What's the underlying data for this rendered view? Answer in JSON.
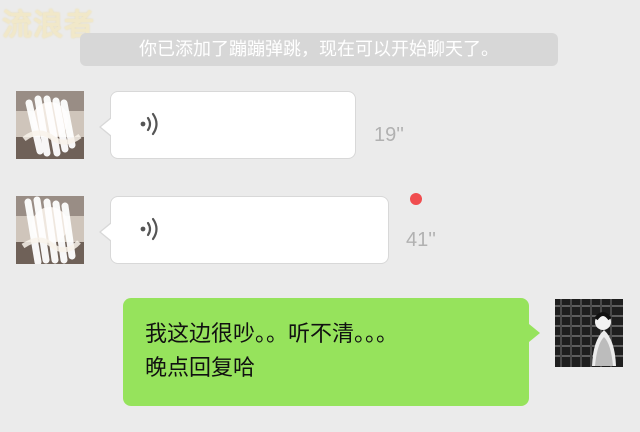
{
  "watermark": {
    "text": "流浪者"
  },
  "system_notice": {
    "text": "你已添加了蹦蹦弹跳，现在可以开始聊天了。"
  },
  "messages": [
    {
      "type": "voice",
      "sender": "left",
      "duration": "19''"
    },
    {
      "type": "voice",
      "sender": "left",
      "duration": "41''",
      "unread": true
    },
    {
      "type": "text",
      "sender": "right",
      "lines": [
        "我这边很吵。。听不清。。。",
        "晚点回复哈"
      ]
    }
  ],
  "icons": {
    "voice": "voice-wave-icon",
    "unread": "unread-dot-icon"
  },
  "colors": {
    "chat_background": "#ebebeb",
    "incoming_bubble": "#ffffff",
    "outgoing_bubble": "#96e35c",
    "notice_background": "#d7d7d7",
    "notice_text": "#ffffff",
    "duration_text": "#b1b1b1",
    "unread_dot": "#f04d4f",
    "watermark": "#f2e8c7"
  }
}
